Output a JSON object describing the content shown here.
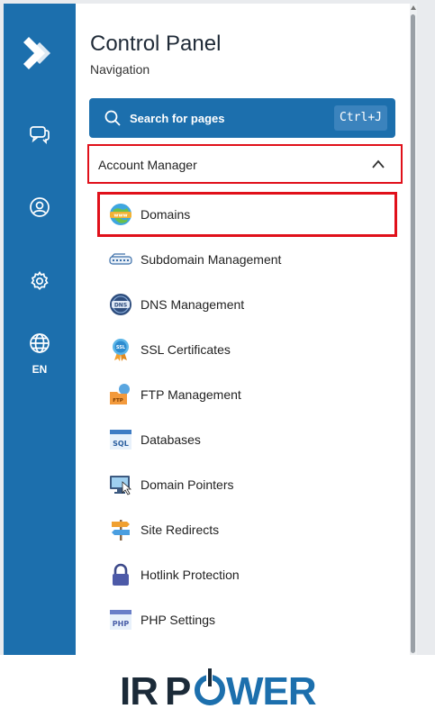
{
  "rail": {
    "lang_label": "EN",
    "colors": {
      "bg": "#1c6fad"
    }
  },
  "panel": {
    "title": "Control Panel",
    "subtitle": "Navigation",
    "search": {
      "label": "Search for pages",
      "shortcut": "Ctrl+J"
    },
    "section": {
      "label": "Account Manager",
      "expanded": true
    },
    "items": [
      {
        "label": "Domains",
        "icon": "www-globe-icon",
        "active": true
      },
      {
        "label": "Subdomain Management",
        "icon": "subdomain-icon"
      },
      {
        "label": "DNS Management",
        "icon": "dns-globe-icon"
      },
      {
        "label": "SSL Certificates",
        "icon": "ssl-badge-icon"
      },
      {
        "label": "FTP Management",
        "icon": "ftp-folder-icon"
      },
      {
        "label": "Databases",
        "icon": "sql-window-icon"
      },
      {
        "label": "Domain Pointers",
        "icon": "monitor-pointer-icon"
      },
      {
        "label": "Site Redirects",
        "icon": "signpost-icon"
      },
      {
        "label": "Hotlink Protection",
        "icon": "lock-icon"
      },
      {
        "label": "PHP Settings",
        "icon": "php-window-icon"
      }
    ]
  },
  "brand": {
    "logo_text": "IRPOWER",
    "colors": {
      "dark": "#1b2a38",
      "blue": "#1c6fad"
    }
  }
}
